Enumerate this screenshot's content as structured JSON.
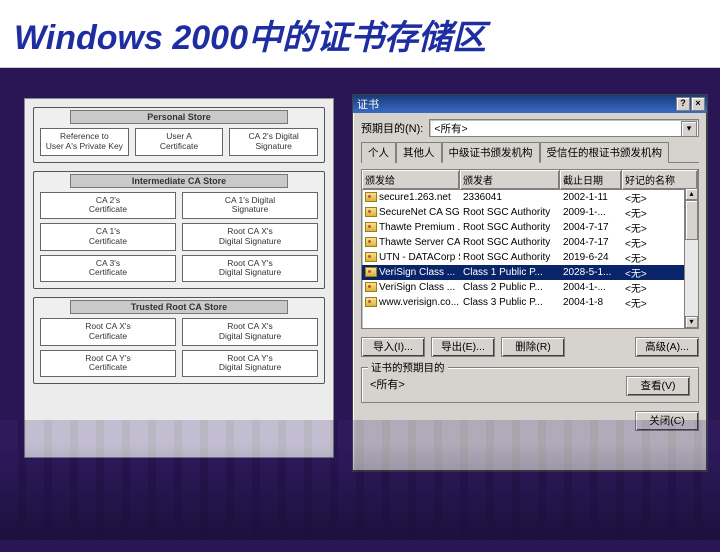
{
  "title": "Windows 2000中的证书存储区",
  "diagram": {
    "stores": [
      {
        "title": "Personal Store",
        "rows": [
          [
            "Reference to\nUser A's Private Key",
            "User A\nCertificate",
            "CA 2's Digital\nSignature"
          ]
        ]
      },
      {
        "title": "Intermediate CA Store",
        "rows": [
          [
            "CA 2's\nCertificate",
            "CA 1's Digital\nSignature"
          ],
          [
            "CA 1's\nCertificate",
            "Root CA X's\nDigital Signature"
          ],
          [
            "CA 3's\nCertificate",
            "Root CA Y's\nDigital Signature"
          ]
        ]
      },
      {
        "title": "Trusted Root CA Store",
        "rows": [
          [
            "Root CA X's\nCertificate",
            "Root CA X's\nDigital Signature"
          ],
          [
            "Root CA Y's\nCertificate",
            "Root CA Y's\nDigital Signature"
          ]
        ]
      }
    ]
  },
  "dialog": {
    "title": "证书",
    "purpose_label": "预期目的(N):",
    "purpose_value": "<所有>",
    "tabs": [
      "个人",
      "其他人",
      "中级证书颁发机构",
      "受信任的根证书颁发机构"
    ],
    "active_tab": 2,
    "columns": [
      "颁发给",
      "颁发者",
      "截止日期",
      "好记的名称"
    ],
    "rows": [
      {
        "to": "secure1.263.net",
        "by": "2336041",
        "exp": "2002-1-11",
        "fn": "<无>",
        "sel": false
      },
      {
        "to": "SecureNet CA SG...",
        "by": "Root SGC Authority",
        "exp": "2009-1-...",
        "fn": "<无>",
        "sel": false
      },
      {
        "to": "Thawte Premium ...",
        "by": "Root SGC Authority",
        "exp": "2004-7-17",
        "fn": "<无>",
        "sel": false
      },
      {
        "to": "Thawte Server CA",
        "by": "Root SGC Authority",
        "exp": "2004-7-17",
        "fn": "<无>",
        "sel": false
      },
      {
        "to": "UTN - DATACorp SGC",
        "by": "Root SGC Authority",
        "exp": "2019-6-24",
        "fn": "<无>",
        "sel": false
      },
      {
        "to": "VeriSign Class ...",
        "by": "Class 1 Public P...",
        "exp": "2028-5-1...",
        "fn": "<无>",
        "sel": true
      },
      {
        "to": "VeriSign Class ...",
        "by": "Class 2 Public P...",
        "exp": "2004-1-...",
        "fn": "<无>",
        "sel": false
      },
      {
        "to": "www.verisign.co...",
        "by": "Class 3 Public P...",
        "exp": "2004-1-8",
        "fn": "<无>",
        "sel": false
      }
    ],
    "buttons": {
      "import": "导入(I)...",
      "export": "导出(E)...",
      "remove": "删除(R)",
      "advanced": "高级(A)..."
    },
    "purpose_group": {
      "legend": "证书的预期目的",
      "value": "<所有>"
    },
    "view_button": "查看(V)",
    "close_button": "关闭(C)"
  }
}
